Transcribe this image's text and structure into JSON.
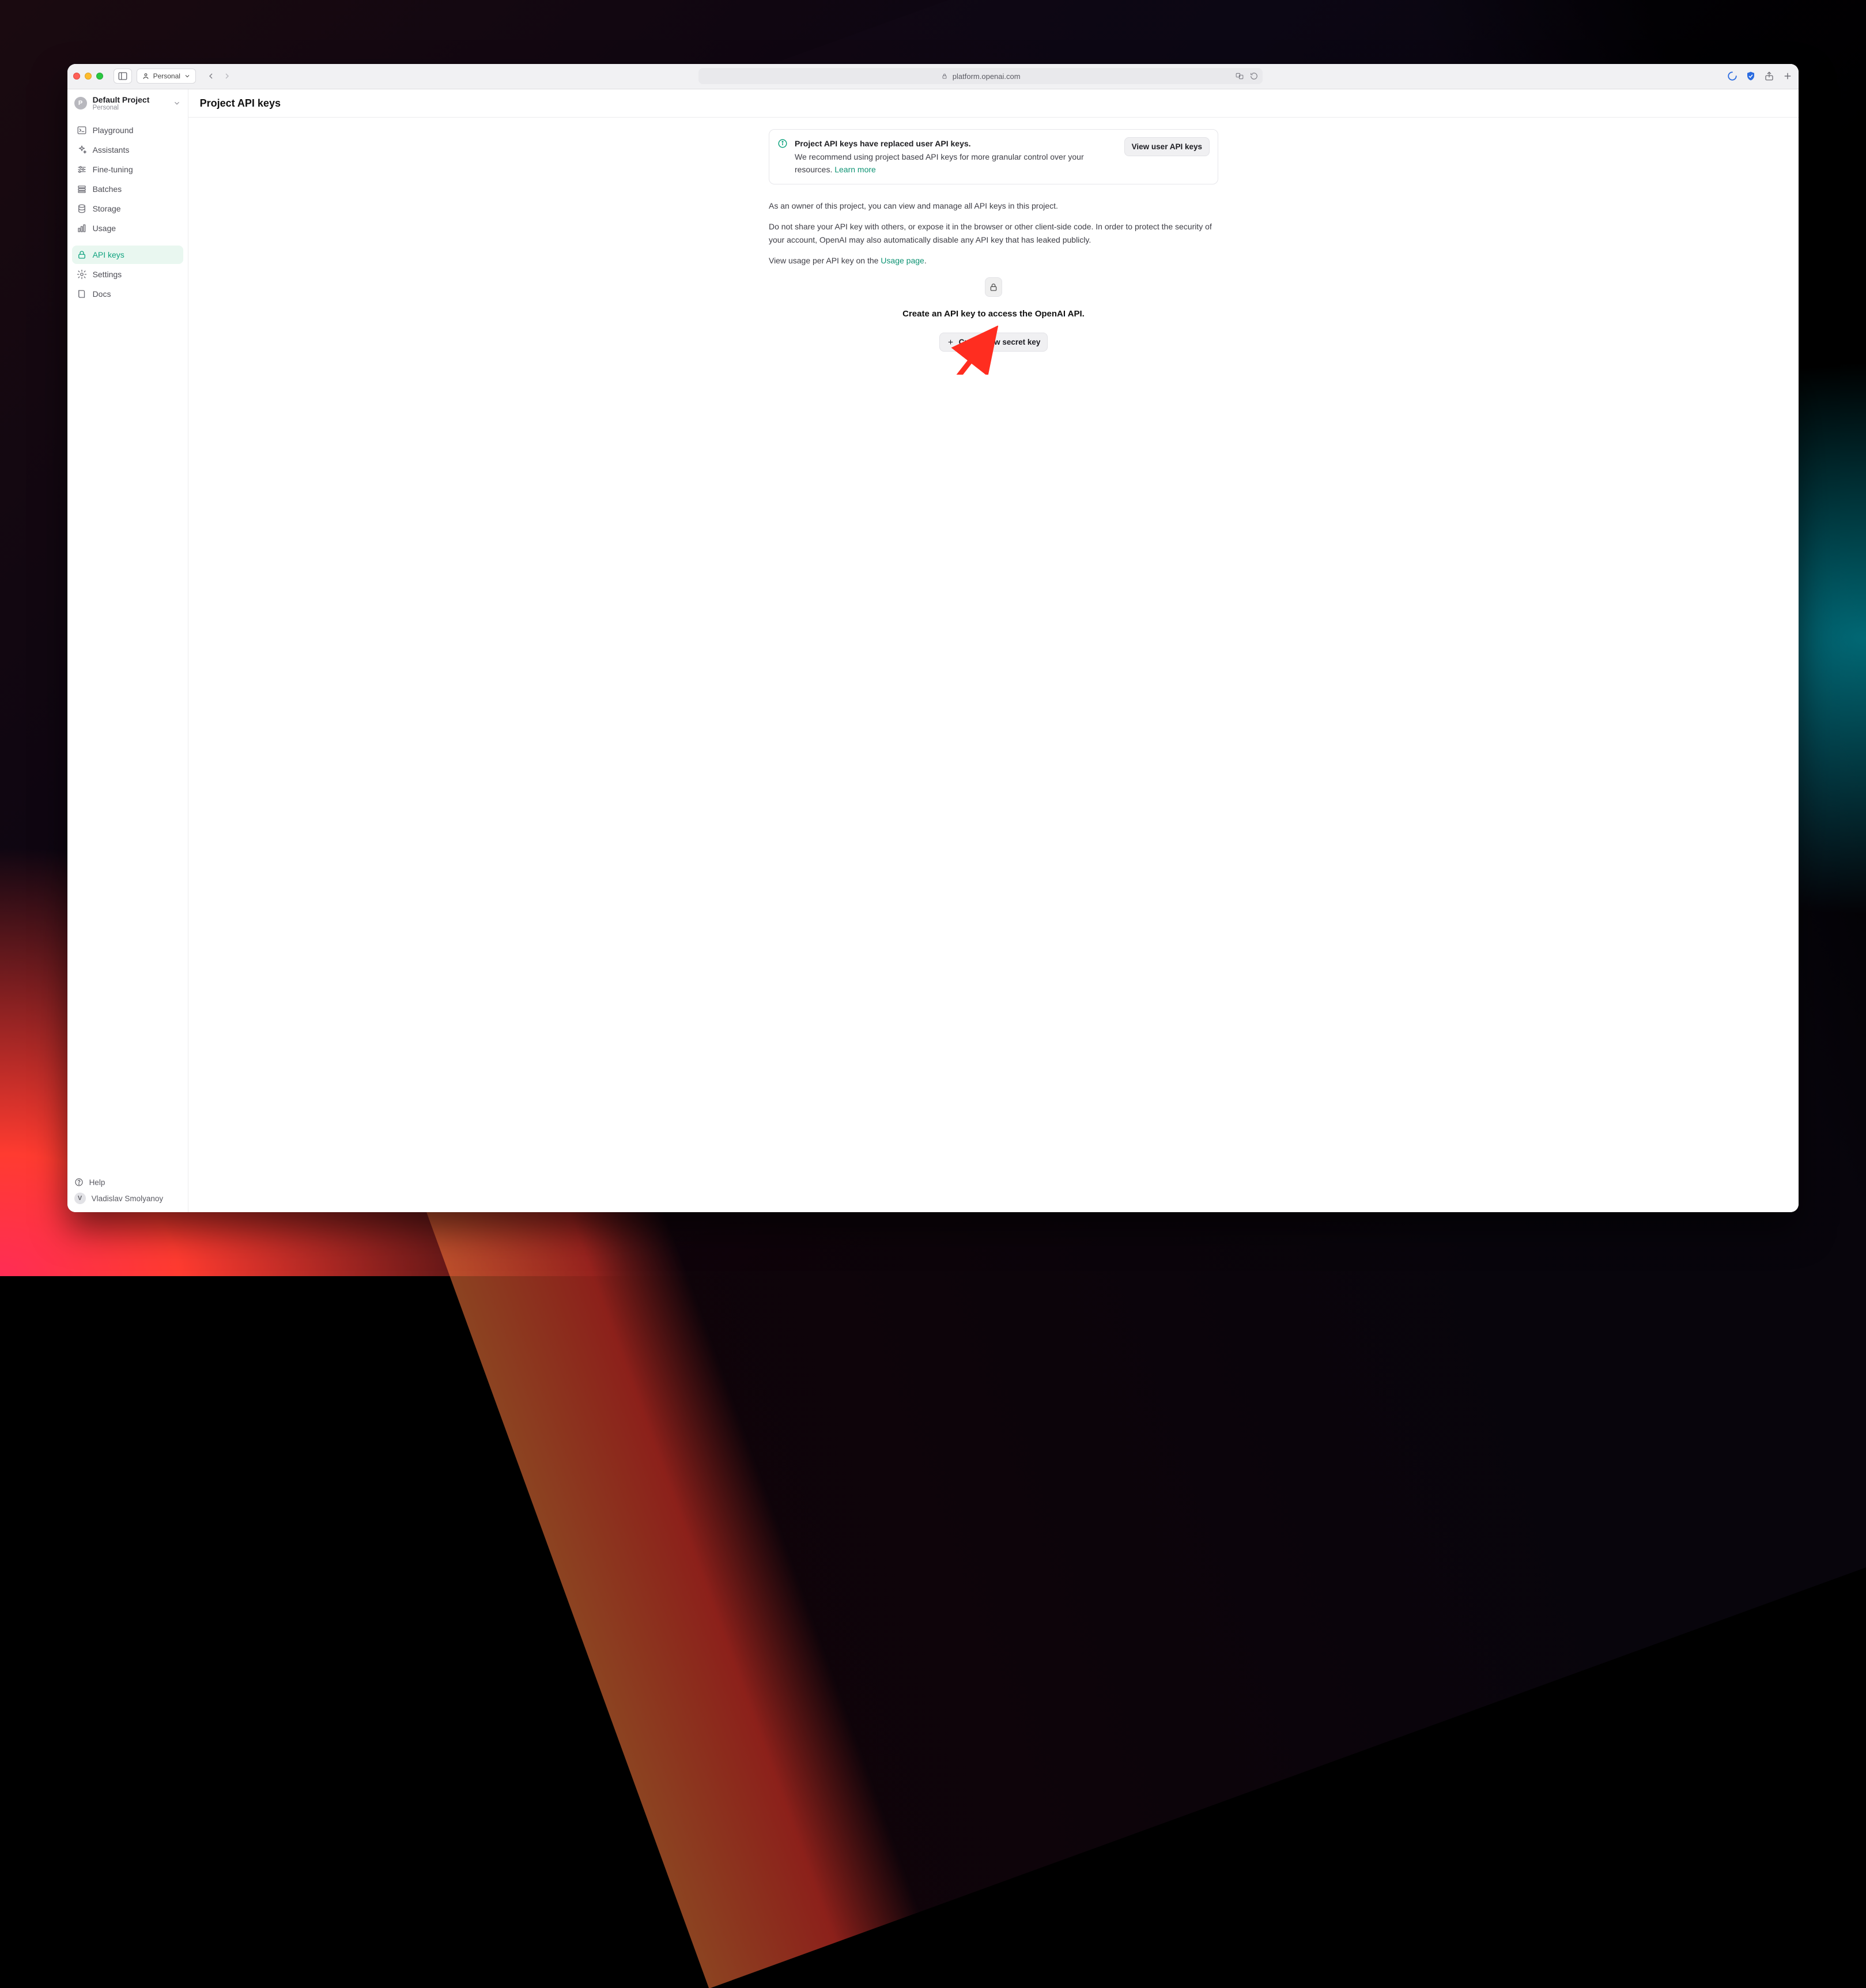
{
  "browser": {
    "profile_label": "Personal",
    "address": "platform.openai.com"
  },
  "sidebar": {
    "project": {
      "name": "Default Project",
      "subtitle": "Personal",
      "initial": "P"
    },
    "items": [
      {
        "id": "playground",
        "label": "Playground",
        "icon": "terminal"
      },
      {
        "id": "assistants",
        "label": "Assistants",
        "icon": "sparkles"
      },
      {
        "id": "finetuning",
        "label": "Fine-tuning",
        "icon": "sliders"
      },
      {
        "id": "batches",
        "label": "Batches",
        "icon": "stack"
      },
      {
        "id": "storage",
        "label": "Storage",
        "icon": "database"
      },
      {
        "id": "usage",
        "label": "Usage",
        "icon": "barchart"
      },
      {
        "id": "apikeys",
        "label": "API keys",
        "icon": "lock",
        "active": true
      },
      {
        "id": "settings",
        "label": "Settings",
        "icon": "gear"
      },
      {
        "id": "docs",
        "label": "Docs",
        "icon": "book"
      }
    ],
    "help_label": "Help",
    "user": {
      "name": "Vladislav Smolyanoy",
      "initial": "V"
    }
  },
  "page": {
    "title": "Project API keys",
    "callout": {
      "title": "Project API keys have replaced user API keys.",
      "body": "We recommend using project based API keys for more granular control over your resources. ",
      "learn_more": "Learn more",
      "button": "View user API keys"
    },
    "p1": "As an owner of this project, you can view and manage all API keys in this project.",
    "p2": "Do not share your API key with others, or expose it in the browser or other client-side code. In order to protect the security of your account, OpenAI may also automatically disable any API key that has leaked publicly.",
    "p3_prefix": "View usage per API key on the ",
    "p3_link": "Usage page",
    "p3_suffix": ".",
    "empty": {
      "title": "Create an API key to access the OpenAI API.",
      "button": "Create new secret key"
    }
  }
}
